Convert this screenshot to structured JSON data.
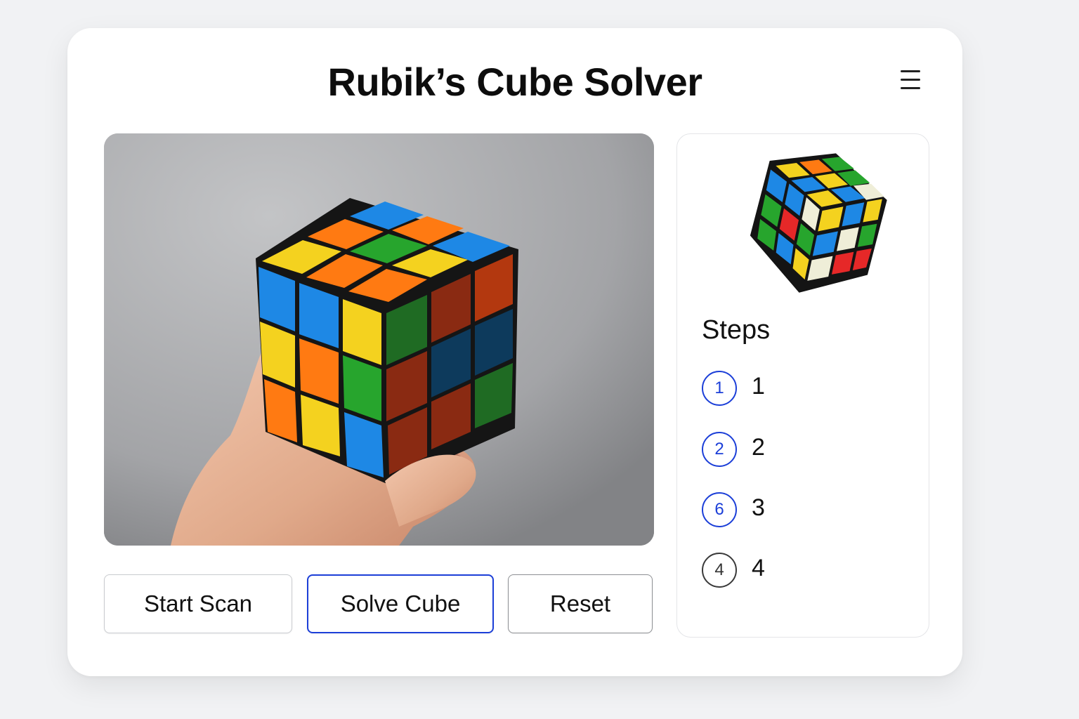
{
  "app": {
    "title": "Rubik’s Cube Solver"
  },
  "header": {
    "menu_icon": "hamburger-menu-icon"
  },
  "camera": {
    "image_description_icon": "cube-photo"
  },
  "actions": {
    "start_scan_label": "Start Scan",
    "solve_cube_label": "Solve Cube",
    "reset_label": "Reset"
  },
  "steps_panel": {
    "title": "Steps",
    "items": [
      {
        "badge": "1",
        "label": "1"
      },
      {
        "badge": "2",
        "label": "2"
      },
      {
        "badge": "6",
        "label": "3"
      },
      {
        "badge": "4",
        "label": "4"
      }
    ]
  },
  "colors": {
    "accent": "#1c3fd8",
    "cube_yellow": "#f4d21f",
    "cube_orange": "#ff7a12",
    "cube_blue": "#1e88e5",
    "cube_green": "#27a52d",
    "cube_red": "#e62828",
    "cube_white": "#efeed8"
  }
}
